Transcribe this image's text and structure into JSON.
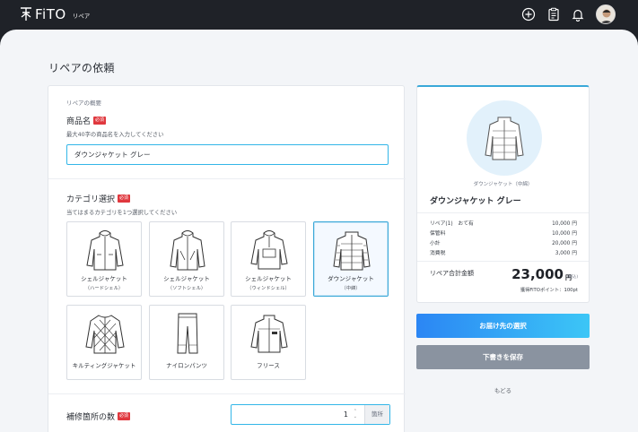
{
  "header": {
    "brand_name": "FiTO",
    "brand_sub": "リペア",
    "icons": [
      "add-circle-icon",
      "clipboard-icon",
      "bell-icon"
    ]
  },
  "page": {
    "title": "リペアの依頼"
  },
  "form": {
    "section_caption": "リペアの概要",
    "required_badge": "必須",
    "product_name": {
      "label": "商品名",
      "hint": "最大40字の商品名を入力してください",
      "value": "ダウンジャケット グレー"
    },
    "category": {
      "label": "カテゴリ選択",
      "hint": "当てはまるカテゴリを1つ選択してください",
      "items": [
        {
          "label": "シェルジャケット",
          "sub": "（ハードシェル）",
          "selected": false,
          "icon": "hardshell-jacket-icon"
        },
        {
          "label": "シェルジャケット",
          "sub": "（ソフトシェル）",
          "selected": false,
          "icon": "softshell-jacket-icon"
        },
        {
          "label": "シェルジャケット",
          "sub": "（ウィンドシェル）",
          "selected": false,
          "icon": "windshell-jacket-icon"
        },
        {
          "label": "ダウンジャケット",
          "sub": "（中綿）",
          "selected": true,
          "icon": "down-jacket-icon"
        },
        {
          "label": "キルティングジャケット",
          "sub": "",
          "selected": false,
          "icon": "quilted-jacket-icon"
        },
        {
          "label": "ナイロンパンツ",
          "sub": "",
          "selected": false,
          "icon": "nylon-pants-icon"
        },
        {
          "label": "フリース",
          "sub": "",
          "selected": false,
          "icon": "fleece-icon"
        }
      ]
    },
    "repair_count": {
      "label": "補修箇所の数",
      "value": "1",
      "unit": "箇所"
    }
  },
  "summary": {
    "image_caption": "ダウンジャケット（中綿）",
    "product_name": "ダウンジャケット グレー",
    "rows": [
      {
        "label": "リペア(1)　おて有",
        "value": "10,000 円"
      },
      {
        "label": "保管料",
        "value": "10,000 円"
      },
      {
        "label": "小計",
        "value": "20,000 円"
      },
      {
        "label": "消費税",
        "value": "3,000 円"
      }
    ],
    "total_label": "リペア合計金額",
    "total_amount": "23,000",
    "total_yen": "円",
    "total_tax": "(税込)",
    "points": "獲得FiTOポイント：100pt"
  },
  "actions": {
    "primary": "お届け先の選択",
    "secondary": "下書きを保存",
    "back": "もどる"
  }
}
